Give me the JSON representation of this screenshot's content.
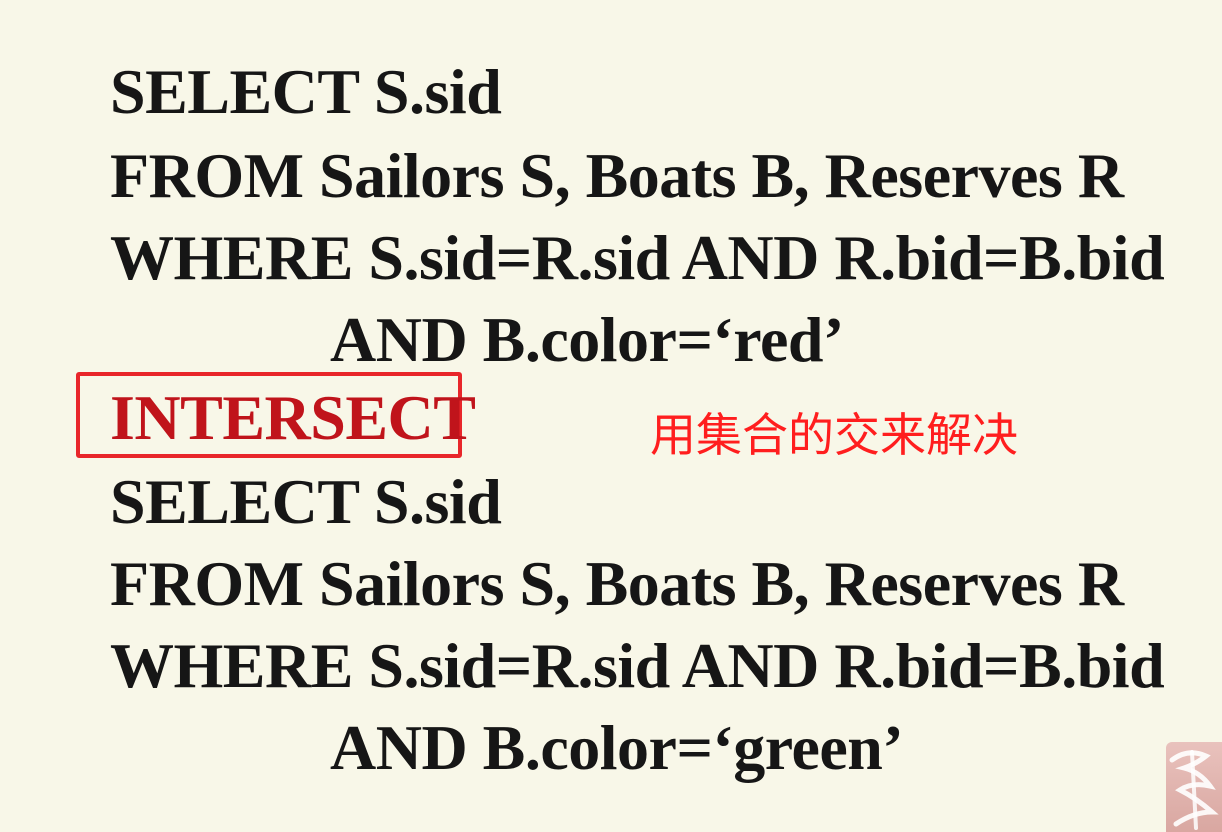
{
  "query": {
    "line1": "SELECT  S.sid",
    "line2": "FROM  Sailors S, Boats B, Reserves R",
    "line3": "WHERE  S.sid=R.sid AND R.bid=B.bid",
    "line4": "AND B.color=‘red’",
    "operator": "INTERSECT",
    "line6": "SELECT  S.sid",
    "line7": "FROM  Sailors S, Boats B, Reserves R",
    "line8": "WHERE  S.sid=R.sid AND R.bid=B.bid",
    "line9": "AND B.color=‘green’"
  },
  "annotation": {
    "note": "用集合的交来解决",
    "box_color": "#e8262a",
    "text_color": "#ff1e1e"
  },
  "colors": {
    "background": "#f8f7e8",
    "text": "#161616",
    "operator": "#c0141b"
  },
  "logo": {
    "icon": "watermark-logo-icon"
  }
}
